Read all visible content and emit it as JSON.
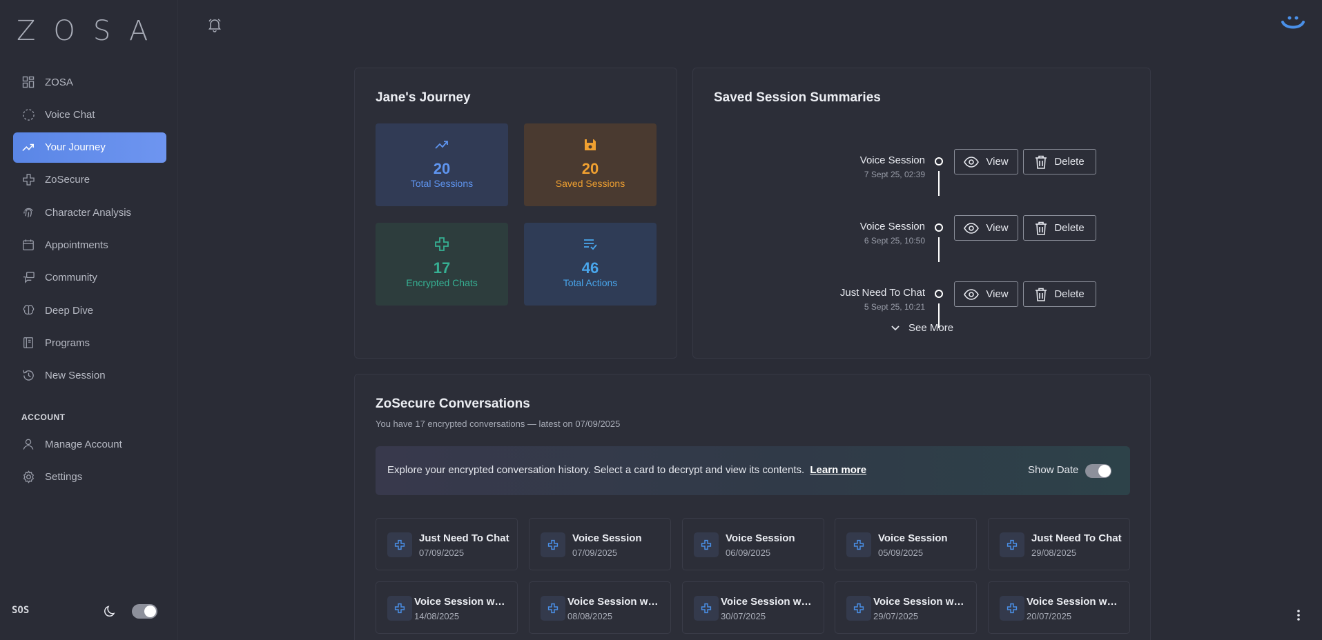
{
  "app": {
    "logo": "ZOSA",
    "sos": "SOS"
  },
  "nav": {
    "items": [
      {
        "label": "ZOSA",
        "icon": "dashboard-icon"
      },
      {
        "label": "Voice Chat",
        "icon": "voice-circle-icon"
      },
      {
        "label": "Your Journey",
        "icon": "trending-up-icon",
        "active": true
      },
      {
        "label": "ZoSecure",
        "icon": "puzzle-cross-icon"
      },
      {
        "label": "Character Analysis",
        "icon": "fingerprint-icon"
      },
      {
        "label": "Appointments",
        "icon": "calendar-icon"
      },
      {
        "label": "Community",
        "icon": "community-icon"
      },
      {
        "label": "Deep Dive",
        "icon": "brain-icon"
      },
      {
        "label": "Programs",
        "icon": "book-icon"
      },
      {
        "label": "New Session",
        "icon": "refresh-clock-icon"
      }
    ],
    "account_heading": "ACCOUNT",
    "account_items": [
      {
        "label": "Manage Account",
        "icon": "user-icon"
      },
      {
        "label": "Settings",
        "icon": "gear-icon"
      }
    ]
  },
  "journey": {
    "title": "Jane's Journey",
    "stats": [
      {
        "value": "20",
        "label": "Total Sessions",
        "icon": "trending-up-icon",
        "color": "#5f95f0"
      },
      {
        "value": "20",
        "label": "Saved Sessions",
        "icon": "save-icon",
        "color": "#f0a030"
      },
      {
        "value": "17",
        "label": "Encrypted Chats",
        "icon": "puzzle-cross-icon",
        "color": "#36b093"
      },
      {
        "value": "46",
        "label": "Total Actions",
        "icon": "checklist-icon",
        "color": "#49a6ec"
      }
    ]
  },
  "saved": {
    "title": "Saved Session Summaries",
    "view_label": "View",
    "delete_label": "Delete",
    "see_more": "See More",
    "sessions": [
      {
        "name": "Voice Session",
        "date": "7 Sept 25, 02:39"
      },
      {
        "name": "Voice Session",
        "date": "6 Sept 25, 10:50"
      },
      {
        "name": "Just Need To Chat",
        "date": "5 Sept 25, 10:21"
      }
    ]
  },
  "zosecure": {
    "title": "ZoSecure Conversations",
    "subtitle": "You have 17 encrypted conversations — latest on 07/09/2025",
    "banner_text": "Explore your encrypted conversation history. Select a card to decrypt and view its contents.",
    "banner_link": "Learn more",
    "show_date_label": "Show Date",
    "conversations": [
      {
        "name": "Just Need To Chat",
        "date": "07/09/2025"
      },
      {
        "name": "Voice Session",
        "date": "07/09/2025"
      },
      {
        "name": "Voice Session",
        "date": "06/09/2025"
      },
      {
        "name": "Voice Session",
        "date": "05/09/2025"
      },
      {
        "name": "Just Need To Chat",
        "date": "29/08/2025"
      },
      {
        "name": "Voice Session wit...",
        "date": "14/08/2025"
      },
      {
        "name": "Voice Session wit...",
        "date": "08/08/2025"
      },
      {
        "name": "Voice Session wit...",
        "date": "30/07/2025"
      },
      {
        "name": "Voice Session wit...",
        "date": "29/07/2025"
      },
      {
        "name": "Voice Session wit...",
        "date": "20/07/2025"
      }
    ]
  }
}
